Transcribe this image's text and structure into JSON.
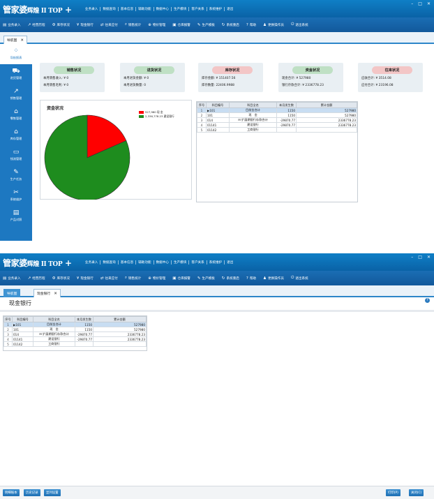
{
  "app": {
    "logo": "管家婆",
    "edition": "辉煌 II TOP",
    "plus": "+",
    "window_controls": [
      "–",
      "□",
      "✕"
    ],
    "main_menu": [
      "业务录入",
      "数据查询",
      "基本信息",
      "辅助功能",
      "数据中心",
      "生产模块",
      "客户关系",
      "系统维护",
      "退出"
    ],
    "toolbar": [
      {
        "label": "业务录入",
        "icon": "form-icon"
      },
      {
        "label": "经营历程",
        "icon": "chart-line-icon"
      },
      {
        "label": "库存状况",
        "icon": "gear-icon"
      },
      {
        "label": "现金银行",
        "icon": "yen-icon"
      },
      {
        "label": "往来应付",
        "icon": "transfer-icon"
      },
      {
        "label": "销售统计",
        "icon": "search-icon"
      },
      {
        "label": "物价管理",
        "icon": "price-icon"
      },
      {
        "label": "仓库报警",
        "icon": "alarm-icon"
      },
      {
        "label": "生产模板",
        "icon": "tool-icon"
      },
      {
        "label": "系统重启",
        "icon": "restart-icon"
      },
      {
        "label": "帮助",
        "icon": "help-icon"
      },
      {
        "label": "更换操作员",
        "icon": "user-switch-icon"
      },
      {
        "label": "退出系统",
        "icon": "power-icon"
      }
    ]
  },
  "screen1": {
    "tab": {
      "label": "导航图",
      "close": "✕"
    },
    "sidebar": [
      {
        "label": "导航报表",
        "icon": "dashboard-icon",
        "glyph": "⁘",
        "selected": true
      },
      {
        "label": "进货管理",
        "icon": "cart-icon",
        "glyph": "⛟"
      },
      {
        "label": "销售管理",
        "icon": "sales-chart-icon",
        "glyph": "↗"
      },
      {
        "label": "零售管理",
        "icon": "tag-icon",
        "glyph": "⌂"
      },
      {
        "label": "库存管理",
        "icon": "warehouse-icon",
        "glyph": "⌂"
      },
      {
        "label": "钱流管理",
        "icon": "money-icon",
        "glyph": "▭"
      },
      {
        "label": "生产任务",
        "icon": "wrench-icon",
        "glyph": "✎"
      },
      {
        "label": "系统维护",
        "icon": "tools-icon",
        "glyph": "✂"
      },
      {
        "label": "产品对照",
        "icon": "document-icon",
        "glyph": "▤"
      }
    ],
    "cards": [
      {
        "title": "销售状况",
        "color": "#bfe0c4",
        "line1": "本月销售收入: ¥ 0",
        "line2": "本月销售毛利: ¥ 0"
      },
      {
        "title": "进货状况",
        "color": "#bfe0c4",
        "line1": "本月进货金额: ¥ 0",
        "line2": "本月进货数量: 0"
      },
      {
        "title": "库存状况",
        "color": "#f3c6c6",
        "line1": "库存金额: ¥ 151407.56",
        "line2": "库存数量: 22406.9988"
      },
      {
        "title": "资金状况",
        "color": "#bfe0c4",
        "line1": "现金合计: ¥ 527980",
        "line2": "银行存款合计: ¥ 2336778.23"
      },
      {
        "title": "往来状况",
        "color": "#f3c6c6",
        "line1": "应收合计: ¥ 3514.08",
        "line2": "应付合计: ¥ 23196.08"
      }
    ],
    "chart_data": {
      "type": "pie",
      "title": "资金状况",
      "slices": [
        {
          "label": "527,980 现 金",
          "value": 527980,
          "color": "#ff0000"
        },
        {
          "label": "2,336,778.23 建设银行",
          "value": 2336778.23,
          "color": "#1e8c1e"
        }
      ]
    }
  },
  "grid": {
    "headers": [
      "序号",
      "科目编号",
      "科目全名",
      "本月发生数",
      "累计金额"
    ],
    "rows": [
      {
        "num": "1",
        "marker": "▶",
        "code": "101",
        "name": "目前金合计",
        "month": "1150",
        "total": "527980",
        "selected": true
      },
      {
        "num": "2",
        "marker": "",
        "code": "101",
        "name": "现　金",
        "month": "1150",
        "total": "527980"
      },
      {
        "num": "3",
        "marker": "",
        "code": "014",
        "name": "⊟ 扩展期银行存款合计",
        "month": "-29870.77",
        "total": "2336778.23"
      },
      {
        "num": "4",
        "marker": "",
        "code": "01141",
        "name": "建设银行",
        "month": "-29870.77",
        "total": "2336778.23"
      },
      {
        "num": "5",
        "marker": "",
        "code": "01142",
        "name": "工商银行",
        "month": "",
        "total": ""
      }
    ]
  },
  "screen2": {
    "tabs": [
      {
        "label": "导航图"
      },
      {
        "label": "现金银行",
        "close": "✕"
      }
    ],
    "page_title": "现金银行",
    "help": "?",
    "bottom_left_buttons": [
      "明细账本",
      "历史记录",
      "显列设置"
    ],
    "bottom_right_buttons": [
      "打印(P)",
      "关闭(C)"
    ]
  }
}
